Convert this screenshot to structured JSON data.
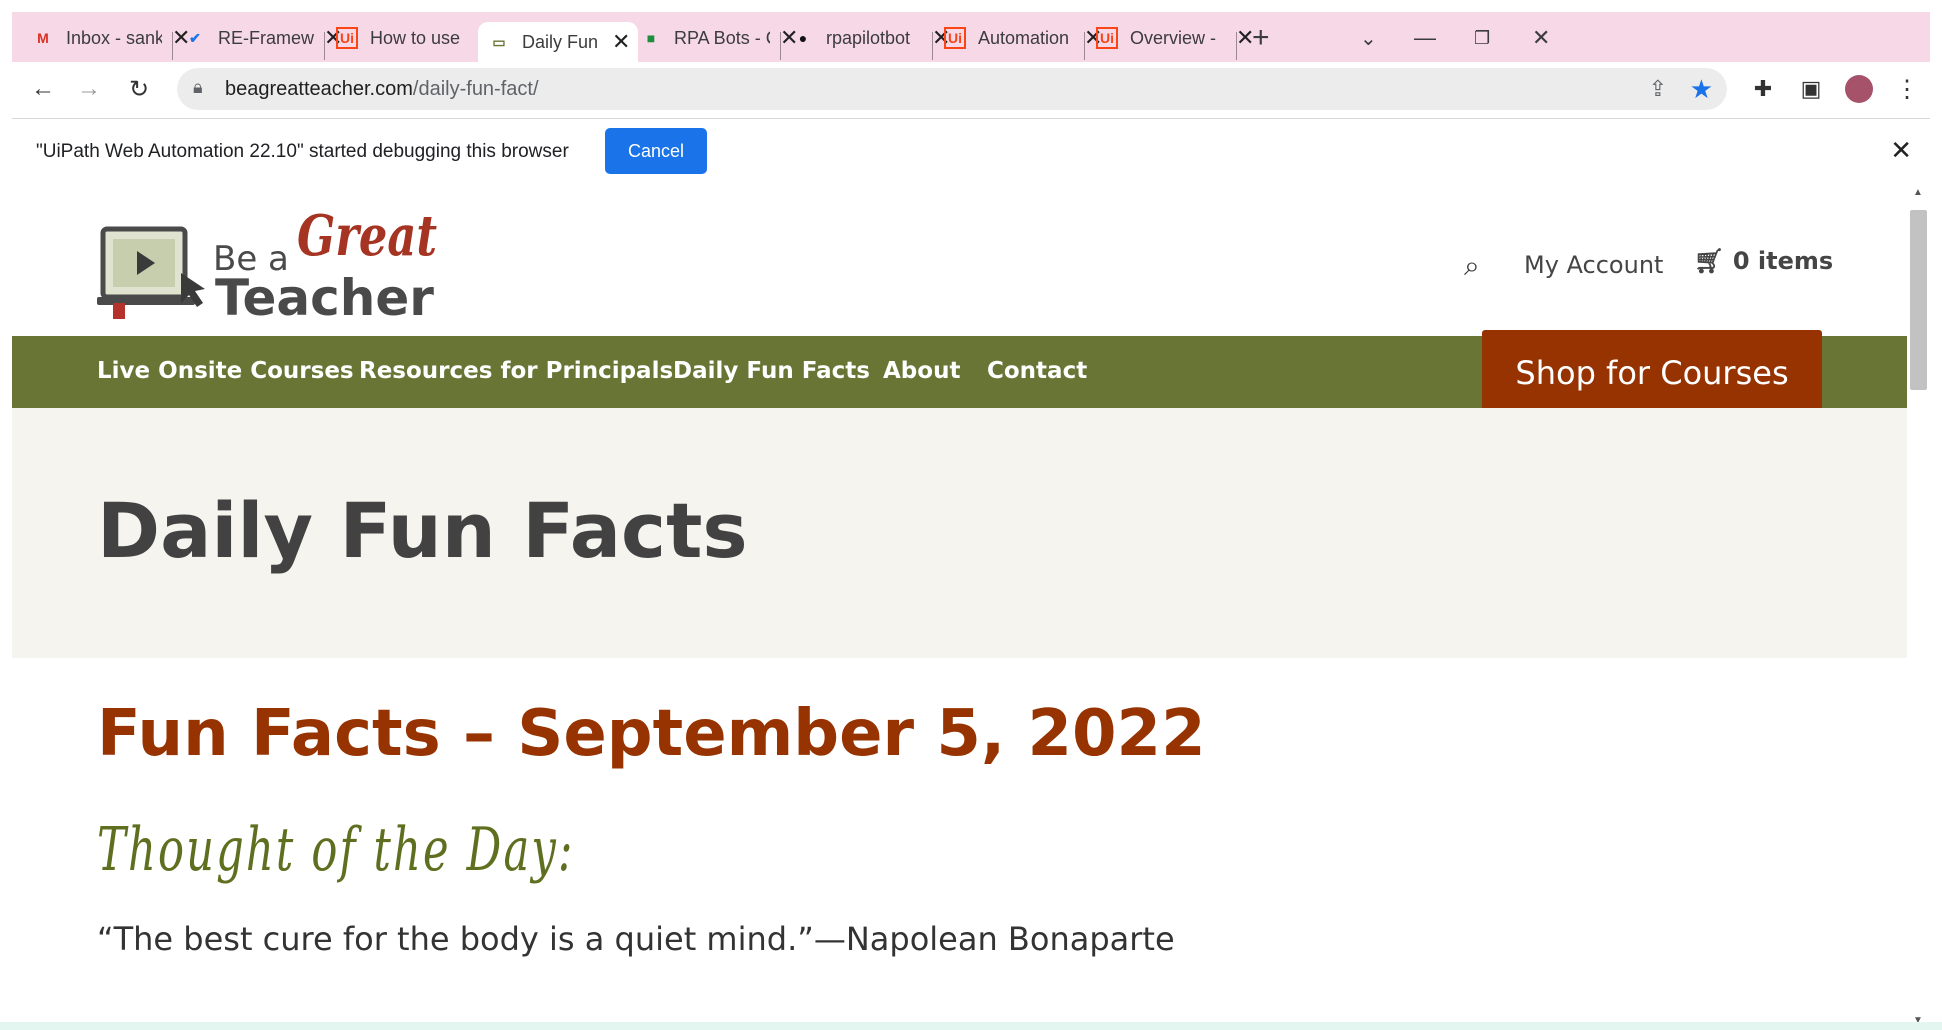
{
  "browser": {
    "tabs": [
      {
        "title": "Inbox - sanket",
        "icon": "gmail-icon",
        "icon_glyph": "M",
        "icon_color": "#d93025"
      },
      {
        "title": "RE-Framework",
        "icon": "check-icon",
        "icon_glyph": "✔",
        "icon_color": "#1a73e8"
      },
      {
        "title": "How to use",
        "icon": "uipath-icon",
        "icon_glyph": "Ui",
        "icon_color": "#fa4616"
      },
      {
        "title": "Daily Fun Facts",
        "icon": "site-favicon-icon",
        "icon_glyph": "▭",
        "icon_color": "#687535"
      },
      {
        "title": "RPA Bots - Chat",
        "icon": "chat-icon",
        "icon_glyph": "■",
        "icon_color": "#1e8e3e"
      },
      {
        "title": "rpapilotbot",
        "icon": "github-icon",
        "icon_glyph": "●",
        "icon_color": "#111111"
      },
      {
        "title": "Automation",
        "icon": "uipath-icon",
        "icon_glyph": "Ui",
        "icon_color": "#fa4616"
      },
      {
        "title": "Overview -",
        "icon": "uipath-icon",
        "icon_glyph": "Ui",
        "icon_color": "#fa4616"
      }
    ],
    "new_tab": "+",
    "url_domain": "beagreatteacher.com",
    "url_path": "/daily-fun-fact/",
    "infobar_message": "\"UiPath Web Automation 22.10\" started debugging this browser",
    "infobar_cancel": "Cancel"
  },
  "site": {
    "logo": {
      "line1": "Be a",
      "great": "Great",
      "line2": "Teacher"
    },
    "my_account": "My Account",
    "cart": "0 items",
    "nav": [
      "Live Onsite Courses",
      "Resources for Principals",
      "Daily Fun Facts",
      "About",
      "Contact"
    ],
    "shop_button": "Shop for Courses",
    "hero_title": "Daily Fun Facts",
    "post_title": "Fun Facts – September 5, 2022",
    "thought_heading": "Thought of the Day:",
    "quote": "“The best cure for the body is a quiet mind.”—Napolean Bonaparte"
  },
  "colors": {
    "tabbar": "#f6d8e7",
    "nav_green": "#687535",
    "brand_rust": "#963301",
    "hero_bg": "#f5f4ef",
    "accent_blue": "#1a73e8"
  }
}
